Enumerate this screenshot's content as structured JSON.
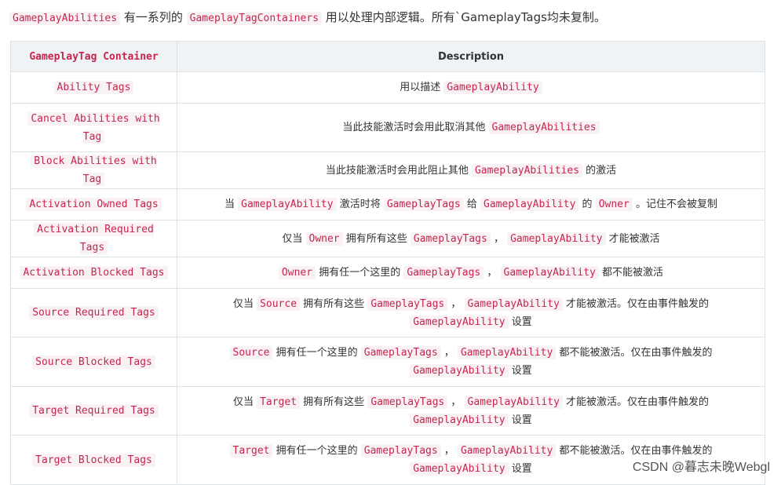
{
  "intro": {
    "code1": "GameplayAbilities",
    "text1": "有一系列的",
    "code2": "GameplayTagContainers",
    "text2": "用以处理内部逻辑。所有`GameplayTags均未复制。"
  },
  "table": {
    "headers": [
      "GameplayTag Container",
      "Description"
    ],
    "rows": [
      {
        "name": "Ability Tags",
        "desc": [
          {
            "t": "text",
            "v": "用以描述 "
          },
          {
            "t": "code",
            "v": "GameplayAbility"
          }
        ]
      },
      {
        "name": "Cancel Abilities with Tag",
        "desc": [
          {
            "t": "text",
            "v": "当此技能激活时会用此取消其他 "
          },
          {
            "t": "code",
            "v": "GameplayAbilities"
          }
        ]
      },
      {
        "name": "Block Abilities with Tag",
        "desc": [
          {
            "t": "text",
            "v": "当此技能激活时会用此阻止其他 "
          },
          {
            "t": "code",
            "v": "GameplayAbilities"
          },
          {
            "t": "text",
            "v": " 的激活"
          }
        ]
      },
      {
        "name": "Activation Owned Tags",
        "desc": [
          {
            "t": "text",
            "v": "当 "
          },
          {
            "t": "code",
            "v": "GameplayAbility"
          },
          {
            "t": "text",
            "v": " 激活时将 "
          },
          {
            "t": "code",
            "v": "GameplayTags"
          },
          {
            "t": "text",
            "v": " 给 "
          },
          {
            "t": "code",
            "v": "GameplayAbility"
          },
          {
            "t": "text",
            "v": " 的 "
          },
          {
            "t": "code",
            "v": "Owner"
          },
          {
            "t": "text",
            "v": " 。记住不会被复制"
          }
        ]
      },
      {
        "name": "Activation Required Tags",
        "desc": [
          {
            "t": "text",
            "v": "仅当 "
          },
          {
            "t": "code",
            "v": "Owner"
          },
          {
            "t": "text",
            "v": " 拥有所有这些 "
          },
          {
            "t": "code",
            "v": "GameplayTags"
          },
          {
            "t": "text",
            "v": " ， "
          },
          {
            "t": "code",
            "v": "GameplayAbility"
          },
          {
            "t": "text",
            "v": " 才能被激活"
          }
        ]
      },
      {
        "name": "Activation Blocked Tags",
        "desc": [
          {
            "t": "code",
            "v": "Owner"
          },
          {
            "t": "text",
            "v": " 拥有任一个这里的 "
          },
          {
            "t": "code",
            "v": "GameplayTags"
          },
          {
            "t": "text",
            "v": " ， "
          },
          {
            "t": "code",
            "v": "GameplayAbility"
          },
          {
            "t": "text",
            "v": " 都不能被激活"
          }
        ]
      },
      {
        "name": "Source Required Tags",
        "desc": [
          {
            "t": "text",
            "v": "仅当 "
          },
          {
            "t": "code",
            "v": "Source"
          },
          {
            "t": "text",
            "v": " 拥有所有这些 "
          },
          {
            "t": "code",
            "v": "GameplayTags"
          },
          {
            "t": "text",
            "v": " ， "
          },
          {
            "t": "code",
            "v": "GameplayAbility"
          },
          {
            "t": "text",
            "v": " 才能被激活。仅在由事件触发的 "
          },
          {
            "t": "code",
            "v": "GameplayAbility"
          },
          {
            "t": "text",
            "v": " 设置"
          }
        ]
      },
      {
        "name": "Source Blocked Tags",
        "desc": [
          {
            "t": "code",
            "v": "Source"
          },
          {
            "t": "text",
            "v": " 拥有任一个这里的 "
          },
          {
            "t": "code",
            "v": "GameplayTags"
          },
          {
            "t": "text",
            "v": " ， "
          },
          {
            "t": "code",
            "v": "GameplayAbility"
          },
          {
            "t": "text",
            "v": " 都不能被激活。仅在由事件触发的 "
          },
          {
            "t": "code",
            "v": "GameplayAbility"
          },
          {
            "t": "text",
            "v": " 设置"
          }
        ]
      },
      {
        "name": "Target Required Tags",
        "desc": [
          {
            "t": "text",
            "v": "仅当 "
          },
          {
            "t": "code",
            "v": "Target"
          },
          {
            "t": "text",
            "v": " 拥有所有这些 "
          },
          {
            "t": "code",
            "v": "GameplayTags"
          },
          {
            "t": "text",
            "v": " ， "
          },
          {
            "t": "code",
            "v": "GameplayAbility"
          },
          {
            "t": "text",
            "v": " 才能被激活。仅在由事件触发的 "
          },
          {
            "t": "code",
            "v": "GameplayAbility"
          },
          {
            "t": "text",
            "v": " 设置"
          }
        ]
      },
      {
        "name": "Target Blocked Tags",
        "desc": [
          {
            "t": "code",
            "v": "Target"
          },
          {
            "t": "text",
            "v": " 拥有任一个这里的 "
          },
          {
            "t": "code",
            "v": "GameplayTags"
          },
          {
            "t": "text",
            "v": " ， "
          },
          {
            "t": "code",
            "v": "GameplayAbility"
          },
          {
            "t": "text",
            "v": " 都不能被激活。仅在由事件触发的 "
          },
          {
            "t": "code",
            "v": "GameplayAbility"
          },
          {
            "t": "text",
            "v": " 设置"
          }
        ]
      }
    ]
  },
  "watermark": "CSDN @暮志未晚Webgl",
  "colors": {
    "code_text": "#c7254e",
    "code_bg": "#f9f2f4",
    "header_bg": "#eff3f5",
    "border": "#dfe2e5"
  }
}
